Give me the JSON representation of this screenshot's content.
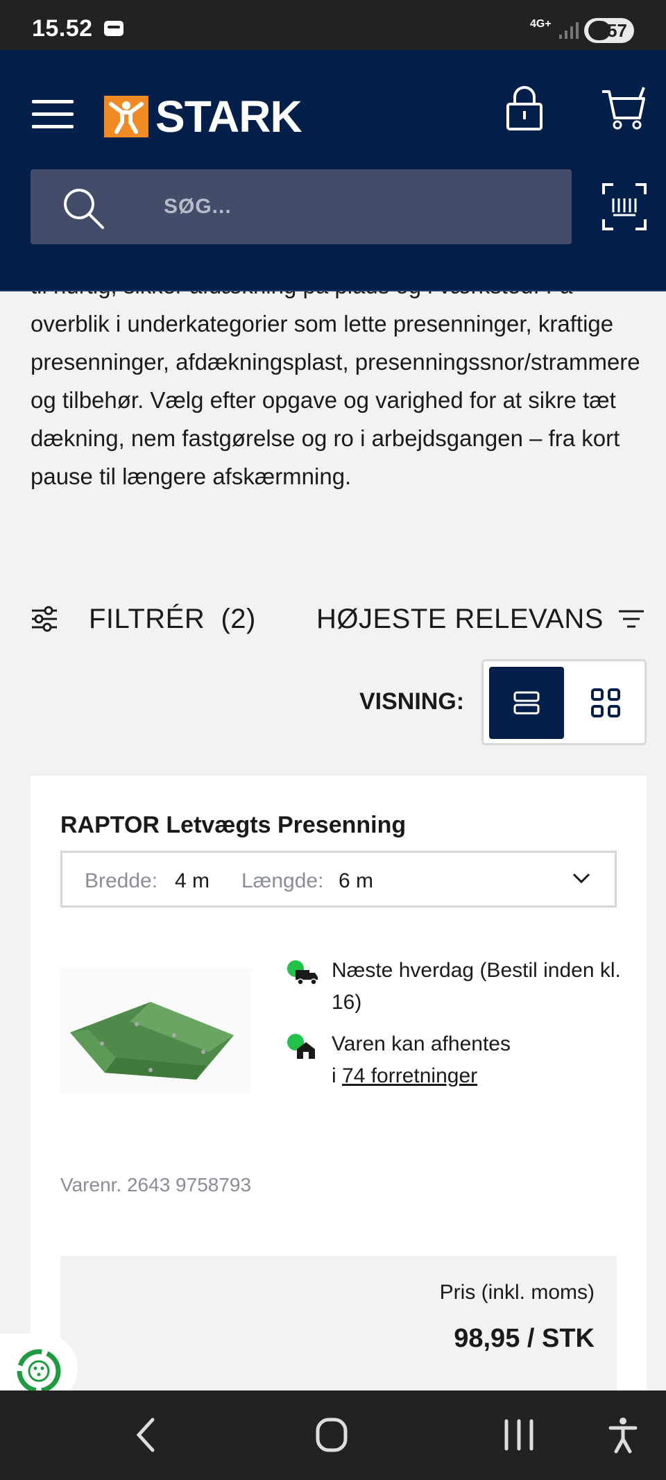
{
  "status_bar": {
    "time": "15.52",
    "network": "4G+",
    "battery": "57"
  },
  "header": {
    "brand": "STARK",
    "brand_color": "#04204a",
    "accent_color": "#f08a24",
    "icons": [
      "menu-icon",
      "lock-icon",
      "cart-icon",
      "barcode-scan-icon"
    ]
  },
  "search": {
    "placeholder": "SØG..."
  },
  "intro": {
    "cut_line": "til hurtig, sikker afdækning på plads og i værksted. Få",
    "text": "overblik i underkategorier som lette presenninger, kraftige presenninger, afdækningsplast, presenningssnor/strammere og tilbehør. Vælg efter opgave og varighed for at sikre tæt dækning, nem fastgørelse og ro i arbejdsgangen – fra kort pause til længere afskærmning."
  },
  "toolbar": {
    "filter_label": "FILTRÉR",
    "filter_count": "(2)",
    "sort_label": "HØJESTE RELEVANS",
    "view_label": "VISNING:"
  },
  "product": {
    "title": "RAPTOR Letvægts Presenning",
    "width_label": "Bredde:",
    "width_value": "4 m",
    "length_label": "Længde:",
    "length_value": "6 m",
    "delivery_text": "Næste hverdag (Bestil inden kl. 16)",
    "pickup_text": "Varen kan afhentes",
    "pickup_prefix": "i",
    "pickup_link": "74 forretninger",
    "availability_color": "#21c24a",
    "sku": "Varenr. 2643 9758793",
    "price_label": "Pris (inkl. moms)",
    "price_value": "98,95 / STK"
  }
}
